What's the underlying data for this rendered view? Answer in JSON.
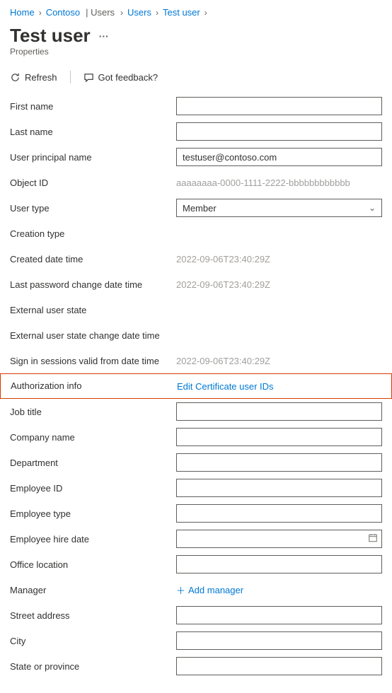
{
  "breadcrumb": {
    "items": [
      {
        "label": "Home"
      },
      {
        "label": "Contoso",
        "suffix": "| Users"
      },
      {
        "label": "Users"
      },
      {
        "label": "Test user"
      }
    ]
  },
  "title": "Test user",
  "subtitle": "Properties",
  "toolbar": {
    "refresh": "Refresh",
    "feedback": "Got feedback?"
  },
  "fields": {
    "first_name": {
      "label": "First name",
      "value": ""
    },
    "last_name": {
      "label": "Last name",
      "value": ""
    },
    "upn": {
      "label": "User principal name",
      "value": "testuser@contoso.com"
    },
    "object_id": {
      "label": "Object ID",
      "value": "aaaaaaaa-0000-1111-2222-bbbbbbbbbbbb"
    },
    "user_type": {
      "label": "User type",
      "value": "Member"
    },
    "creation_type": {
      "label": "Creation type"
    },
    "created": {
      "label": "Created date time",
      "value": "2022-09-06T23:40:29Z"
    },
    "last_pwd": {
      "label": "Last password change date time",
      "value": "2022-09-06T23:40:29Z"
    },
    "ext_state": {
      "label": "External user state"
    },
    "ext_state_change": {
      "label": "External user state change date time"
    },
    "signin_valid": {
      "label": "Sign in sessions valid from date time",
      "value": "2022-09-06T23:40:29Z"
    },
    "auth_info": {
      "label": "Authorization info",
      "link": "Edit Certificate user IDs"
    },
    "job_title": {
      "label": "Job title",
      "value": ""
    },
    "company": {
      "label": "Company name",
      "value": ""
    },
    "department": {
      "label": "Department",
      "value": ""
    },
    "emp_id": {
      "label": "Employee ID",
      "value": ""
    },
    "emp_type": {
      "label": "Employee type",
      "value": ""
    },
    "emp_hire": {
      "label": "Employee hire date",
      "value": ""
    },
    "office": {
      "label": "Office location",
      "value": ""
    },
    "manager": {
      "label": "Manager",
      "link": "Add manager"
    },
    "street": {
      "label": "Street address",
      "value": ""
    },
    "city": {
      "label": "City",
      "value": ""
    },
    "state": {
      "label": "State or province",
      "value": ""
    }
  }
}
